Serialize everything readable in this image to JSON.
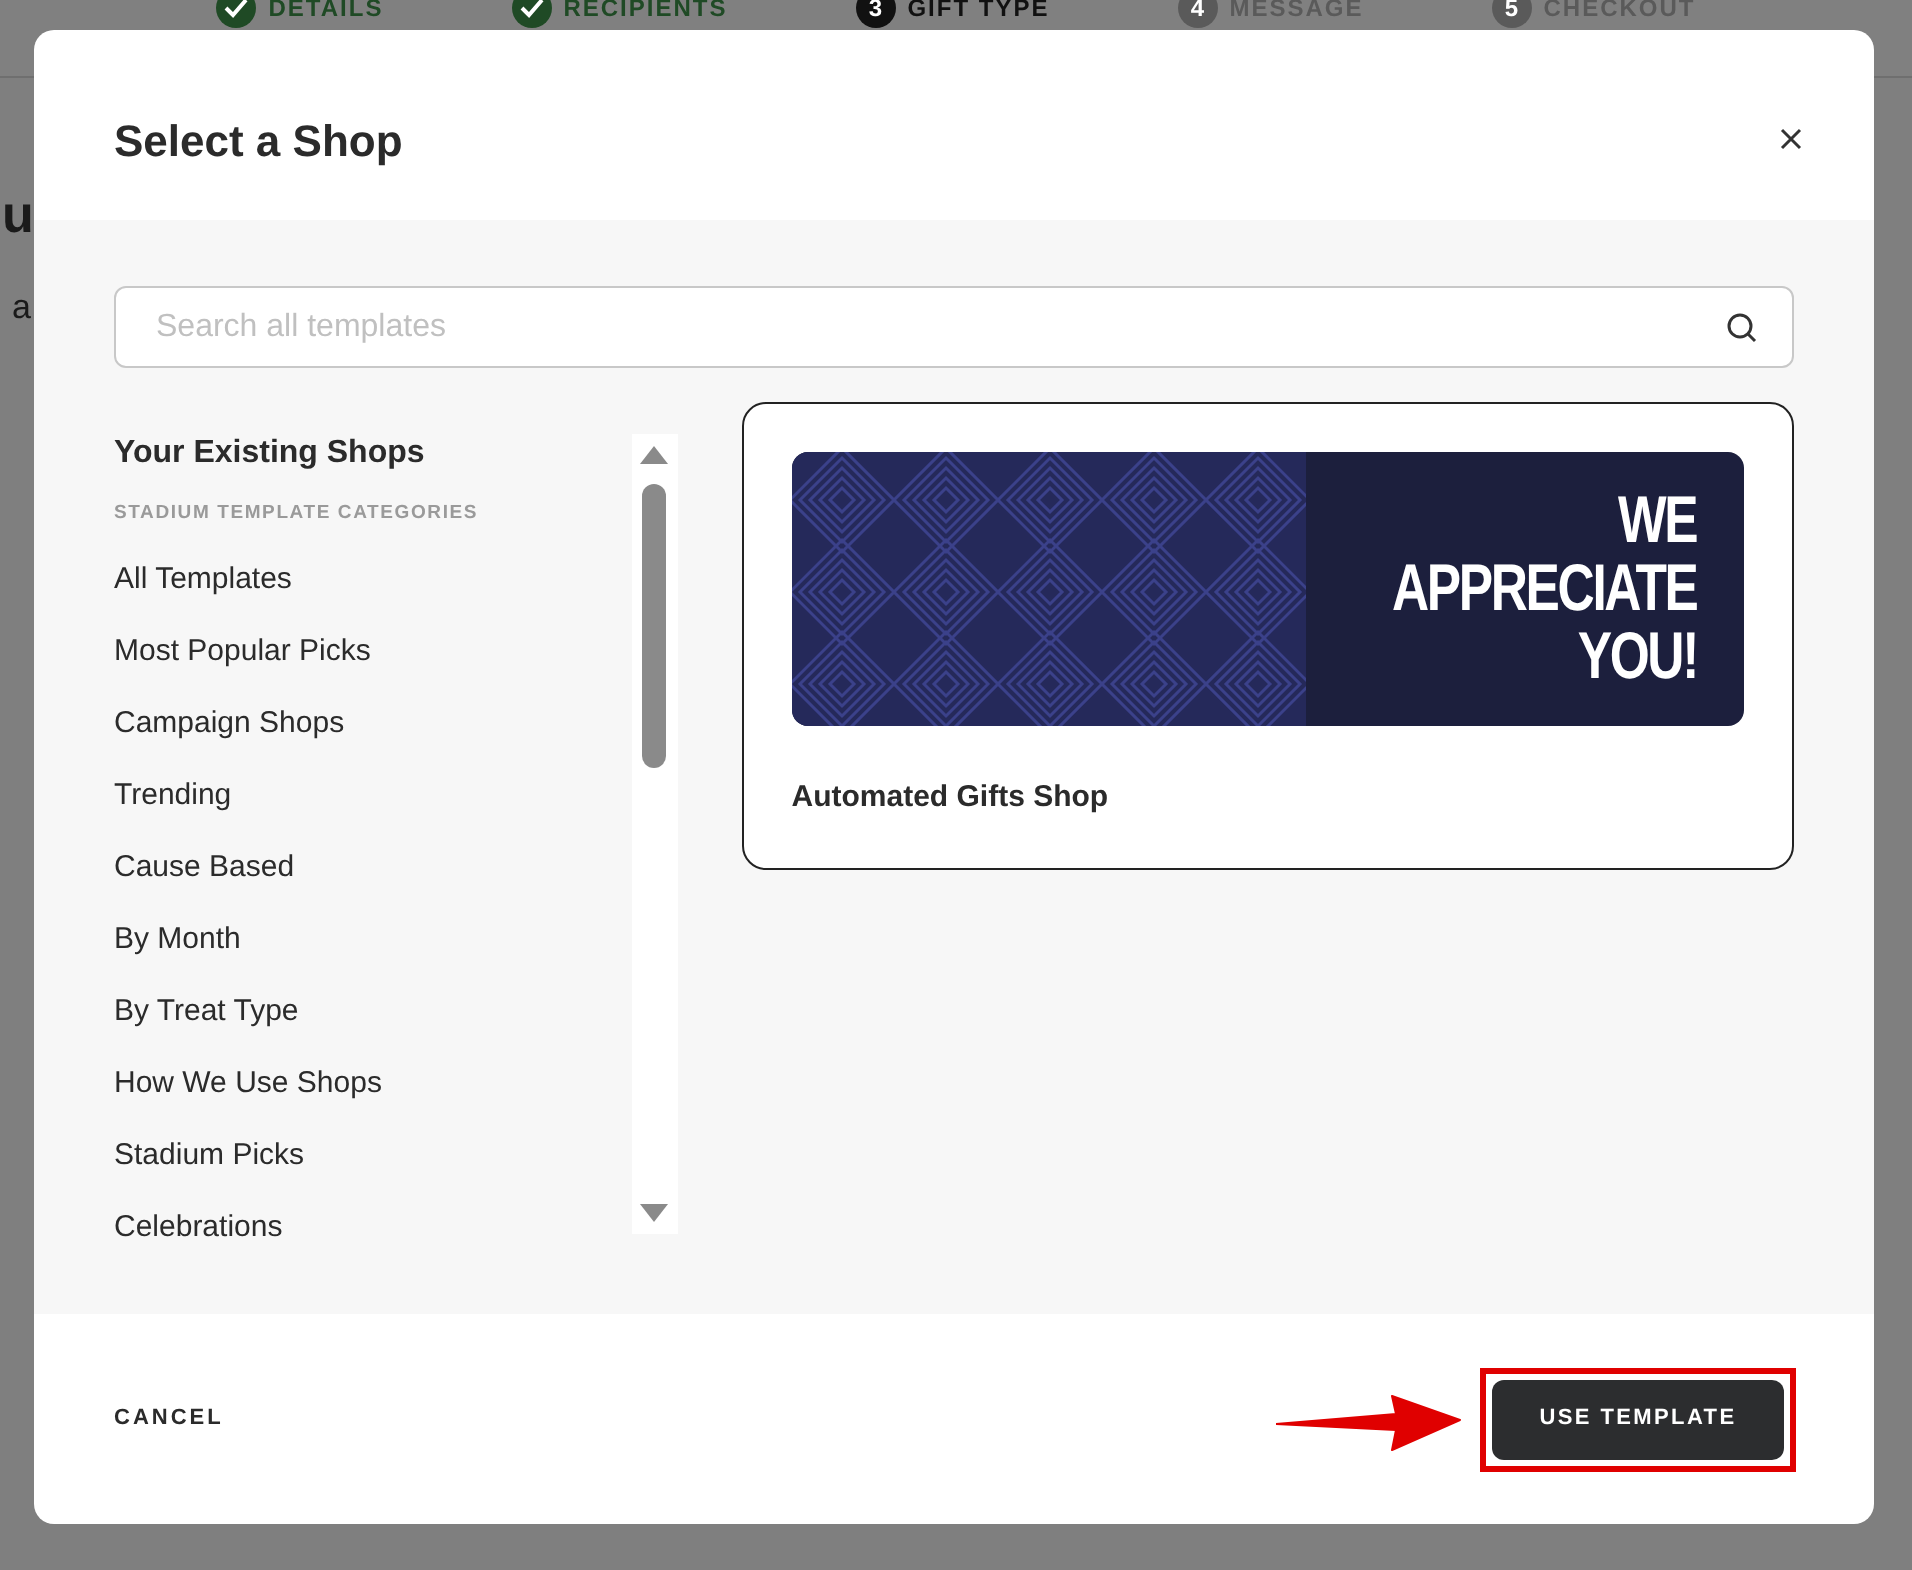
{
  "stepper": [
    {
      "label": "DETAILS",
      "completed": true,
      "selected": false
    },
    {
      "label": "RECIPIENTS",
      "completed": true,
      "selected": false
    },
    {
      "label": "GIFT TYPE",
      "number": "3",
      "completed": false,
      "selected": true
    },
    {
      "label": "MESSAGE",
      "number": "4",
      "completed": false,
      "selected": false
    },
    {
      "label": "CHECKOUT",
      "number": "5",
      "completed": false,
      "selected": false
    }
  ],
  "background": {
    "heading_fragment": "u",
    "text_fragment": "a"
  },
  "modal": {
    "title": "Select a Shop",
    "search": {
      "placeholder": "Search all templates"
    },
    "sidebar": {
      "existing_shops": "Your Existing Shops",
      "section_label": "STADIUM TEMPLATE CATEGORIES",
      "items": [
        "All Templates",
        "Most Popular Picks",
        "Campaign Shops",
        "Trending",
        "Cause Based",
        "By Month",
        "By Treat Type",
        "How We Use Shops",
        "Stadium Picks",
        "Celebrations"
      ]
    },
    "templates": [
      {
        "name": "Automated Gifts Shop",
        "banner_lines": [
          "WE",
          "APPRECIATE",
          "YOU!"
        ]
      }
    ],
    "footer": {
      "cancel": "CANCEL",
      "confirm": "USE TEMPLATE"
    }
  }
}
